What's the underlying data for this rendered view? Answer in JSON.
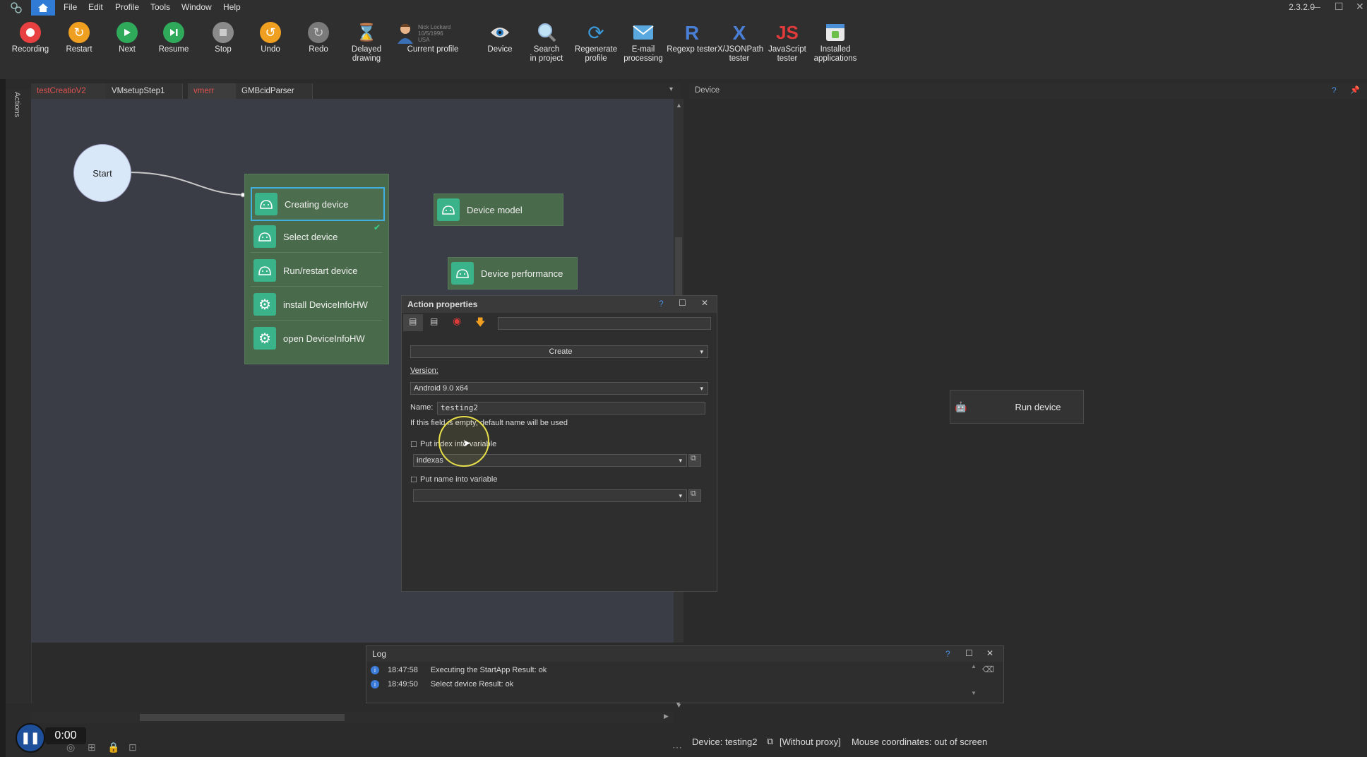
{
  "menubar": {
    "items": [
      "File",
      "Edit",
      "Profile",
      "Tools",
      "Window",
      "Help"
    ],
    "version": "2.3.2.0"
  },
  "toolbar": {
    "recording": "Recording",
    "restart": "Restart",
    "next": "Next",
    "resume": "Resume",
    "stop": "Stop",
    "undo": "Undo",
    "redo": "Redo",
    "delayed_drawing": "Delayed drawing",
    "current_profile": "Current profile",
    "profile_name": "Nick Lockard",
    "profile_date": "10/5/1996",
    "profile_country": "USA",
    "device": "Device",
    "search_in_project": "Search in project",
    "regenerate_profile": "Regenerate profile",
    "email_processing": "E-mail processing",
    "regexp_tester": "Regexp tester",
    "xjsonpath_tester": "X/JSONPath tester",
    "javascript_tester": "JavaScript tester",
    "installed_applications": "Installed applications"
  },
  "left_strip": {
    "label": "Actions"
  },
  "tabs": [
    {
      "label": "testCreatioV2",
      "color": "#e05050"
    },
    {
      "label": "VMsetupStep1",
      "color": "#dddddd"
    },
    {
      "label": "vmerr",
      "color": "#e05050"
    },
    {
      "label": "GMBcidParser",
      "color": "#dddddd"
    }
  ],
  "canvas": {
    "start_label": "Start",
    "group_items": [
      "Creating device",
      "Select device",
      "Run/restart device",
      "install DeviceInfoHW",
      "open DeviceInfoHW"
    ],
    "device_model": "Device model",
    "device_performance": "Device performance"
  },
  "action_properties": {
    "title": "Action properties",
    "mode": "Create",
    "version_label": "Version:",
    "version_value": "Android 9.0 x64",
    "name_label": "Name:",
    "name_value": "testing2",
    "hint": "If this field is empty, default name will be used",
    "put_index_label": "Put index into variable",
    "index_value": "indexas",
    "put_name_label": "Put name into variable",
    "name_var_value": ""
  },
  "device_panel": {
    "title": "Device",
    "run_device": "Run device"
  },
  "log": {
    "title": "Log",
    "rows": [
      {
        "time": "18:47:58",
        "message": "Executing the StartApp  Result: ok"
      },
      {
        "time": "18:49:50",
        "message": "Select device  Result: ok"
      }
    ]
  },
  "status": {
    "device": "Device: testing2",
    "proxy": "[Without proxy]",
    "mouse": "Mouse coordinates: out of screen"
  },
  "recorder": {
    "time": "0:00"
  }
}
